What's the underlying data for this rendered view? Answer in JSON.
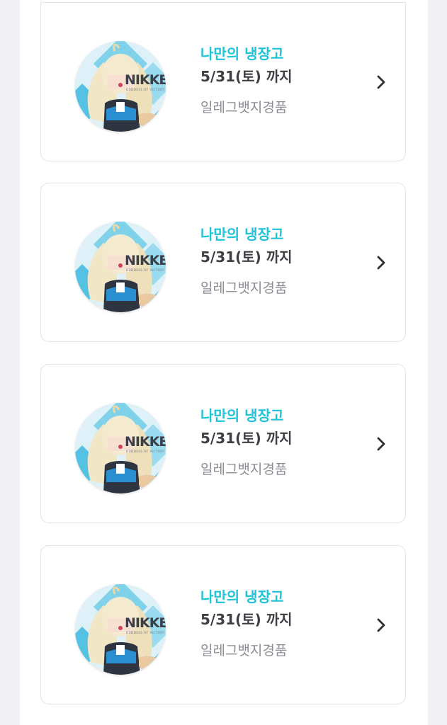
{
  "events": [
    {
      "title": "나만의 냉장고",
      "deadline": "5/31(토) 까지",
      "reward": "일레그뱃지경품",
      "badge_logo": "NIKKE",
      "badge_subtitle": "GODDESS OF VICTORY",
      "icon": "chevron-right-icon"
    },
    {
      "title": "나만의 냉장고",
      "deadline": "5/31(토) 까지",
      "reward": "일레그뱃지경품",
      "badge_logo": "NIKKE",
      "badge_subtitle": "GODDESS OF VICTORY",
      "icon": "chevron-right-icon"
    },
    {
      "title": "나만의 냉장고",
      "deadline": "5/31(토) 까지",
      "reward": "일레그뱃지경품",
      "badge_logo": "NIKKE",
      "badge_subtitle": "GODDESS OF VICTORY",
      "icon": "chevron-right-icon"
    },
    {
      "title": "나만의 냉장고",
      "deadline": "5/31(토) 까지",
      "reward": "일레그뱃지경품",
      "badge_logo": "NIKKE",
      "badge_subtitle": "GODDESS OF VICTORY",
      "icon": "chevron-right-icon"
    }
  ],
  "colors": {
    "accent": "#1ec3d8",
    "text_dark": "#3d3f45",
    "text_muted": "#8b8d94",
    "border": "#e2e3e8",
    "background": "#f1f1f5"
  }
}
